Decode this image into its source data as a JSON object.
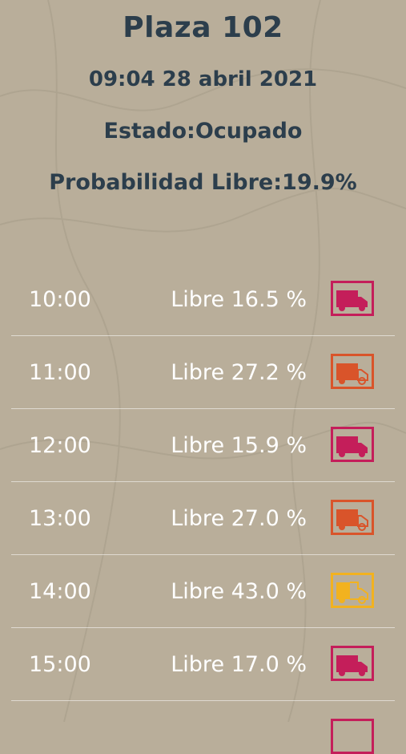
{
  "header": {
    "title": "Plaza 102",
    "datetime": "09:04 28 abril 2021",
    "status": "Estado:Ocupado",
    "probability": "Probabilidad Libre:19.9%"
  },
  "forecast": [
    {
      "time": "10:00",
      "label": "Libre 16.5 %",
      "icon": "truck-full-icon",
      "color": "#c41e5a"
    },
    {
      "time": "11:00",
      "label": "Libre 27.2 %",
      "icon": "truck-partial-icon",
      "color": "#d9542a"
    },
    {
      "time": "12:00",
      "label": "Libre 15.9 %",
      "icon": "truck-full-icon",
      "color": "#c41e5a"
    },
    {
      "time": "13:00",
      "label": "Libre 27.0 %",
      "icon": "truck-partial-icon",
      "color": "#d9542a"
    },
    {
      "time": "14:00",
      "label": "Libre 43.0 %",
      "icon": "truck-half-icon",
      "color": "#f2b21f"
    },
    {
      "time": "15:00",
      "label": "Libre 17.0 %",
      "icon": "truck-full-icon",
      "color": "#c41e5a"
    }
  ]
}
